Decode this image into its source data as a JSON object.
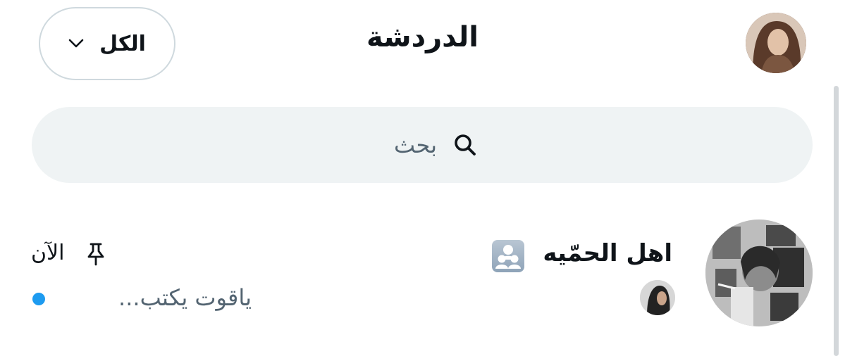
{
  "header": {
    "title": "الدردشة",
    "filter_label": "الكل"
  },
  "search": {
    "placeholder": "بحث"
  },
  "chats": [
    {
      "name": "اهل الحمّيه",
      "status": "ياقوت يكتب...",
      "time": "الآن",
      "pinned": true,
      "unread": true
    }
  ],
  "icons": {
    "filter": "chevron-down-icon",
    "search": "search-icon",
    "pin": "pin-icon",
    "group": "group-icon"
  },
  "colors": {
    "accent": "#1d9bf0",
    "search_bg": "#eff3f4",
    "muted_text": "#536471"
  }
}
